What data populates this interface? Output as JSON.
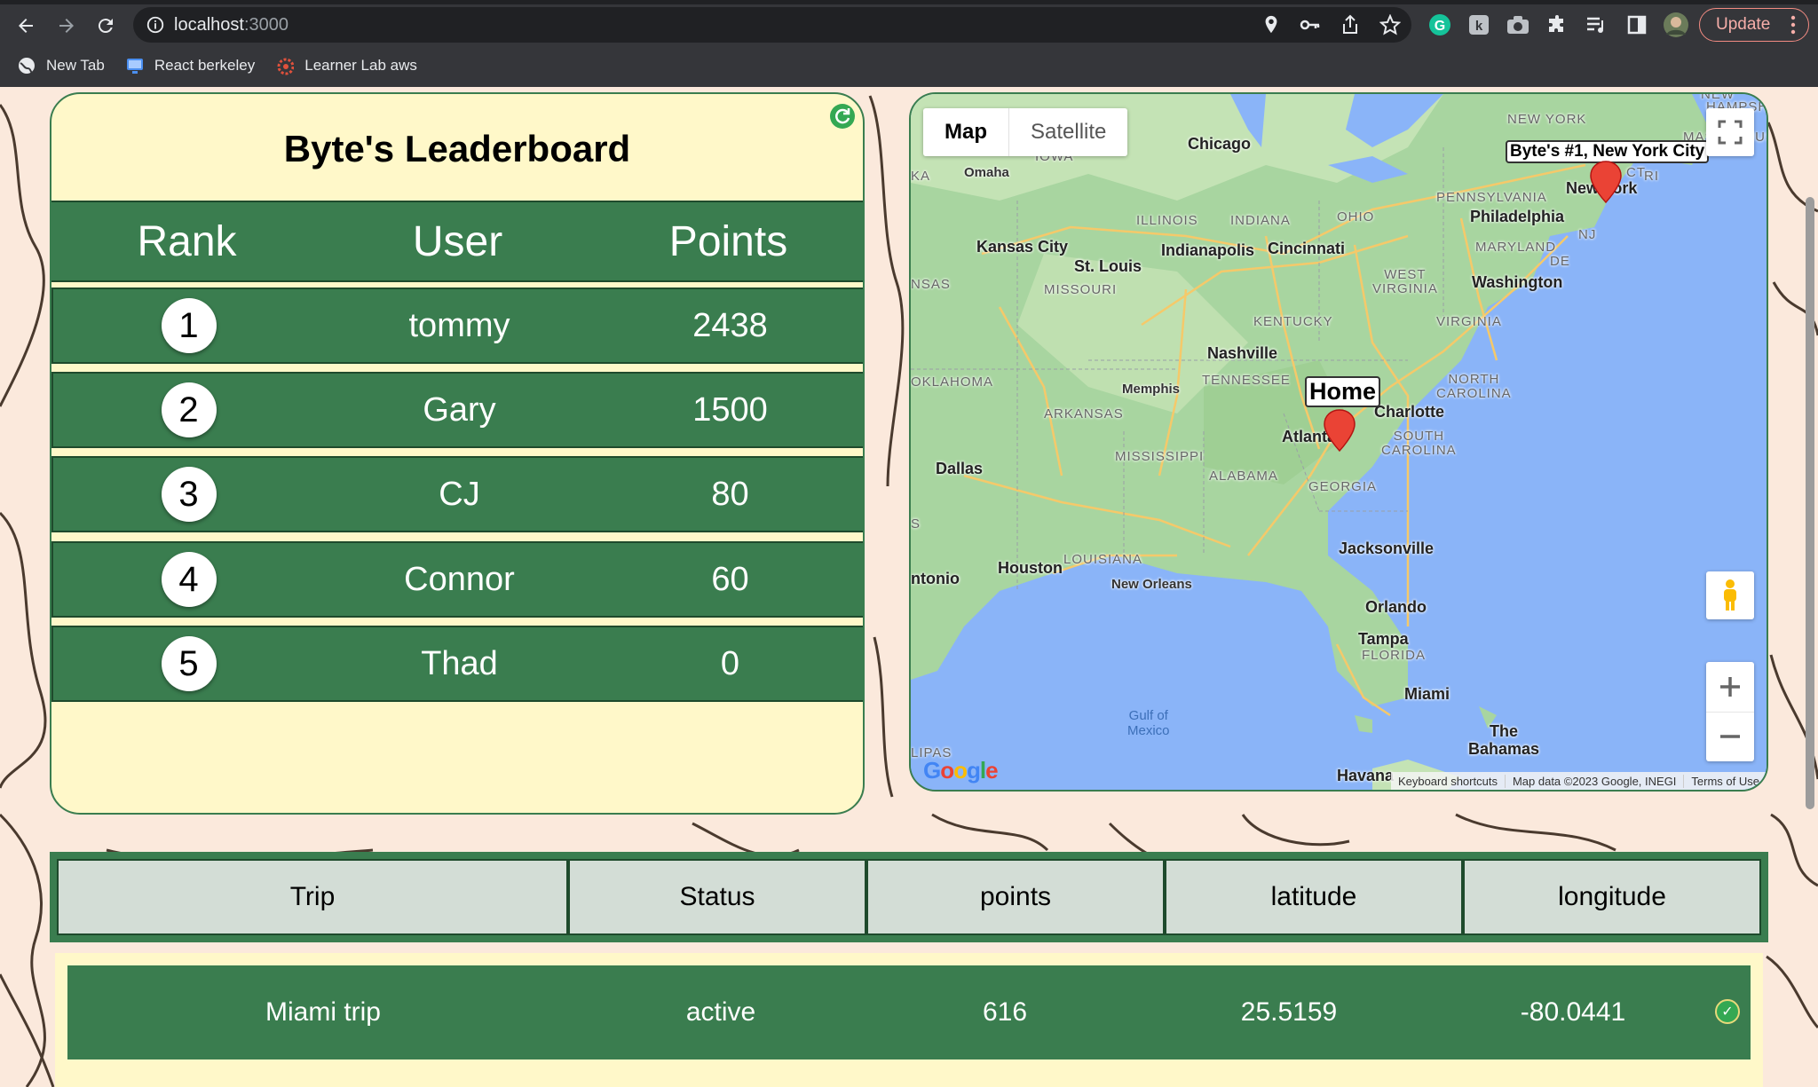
{
  "browser": {
    "url_host": "localhost",
    "url_port": ":3000",
    "update_label": "Update",
    "bookmarks": [
      {
        "label": "New Tab",
        "icon": "globe-icon"
      },
      {
        "label": "React berkeley",
        "icon": "monitor-icon"
      },
      {
        "label": "Learner Lab aws",
        "icon": "aws-icon"
      }
    ]
  },
  "leaderboard": {
    "title": "Byte's Leaderboard",
    "columns": [
      "Rank",
      "User",
      "Points"
    ],
    "rows": [
      {
        "rank": "1",
        "user": "tommy",
        "points": "2438"
      },
      {
        "rank": "2",
        "user": "Gary",
        "points": "1500"
      },
      {
        "rank": "3",
        "user": "CJ",
        "points": "80"
      },
      {
        "rank": "4",
        "user": "Connor",
        "points": "60"
      },
      {
        "rank": "5",
        "user": "Thad",
        "points": "0"
      }
    ]
  },
  "map": {
    "type_buttons": {
      "map": "Map",
      "satellite": "Satellite"
    },
    "markers": {
      "nyc": "Byte's #1, New York City",
      "home": "Home"
    },
    "labels": {
      "chicago": "Chicago",
      "omaha": "Omaha",
      "iowa": "IOWA",
      "kansas_city": "Kansas City",
      "st_louis": "St. Louis",
      "missouri": "MISSOURI",
      "illinois": "ILLINOIS",
      "indiana": "INDIANA",
      "ohio": "OHIO",
      "indianapolis": "Indianapolis",
      "cincinnati": "Cincinnati",
      "pennsylvania": "PENNSYLVANIA",
      "new_york_state": "NEW YORK",
      "massachusetts": "MASSACHUSE",
      "hampshire": "HAMPSHIRE",
      "new": "NEW",
      "ct": "CT",
      "ri": "RI",
      "new_york": "New York",
      "philadelphia": "Philadelphia",
      "maryland": "MARYLAND",
      "nj": "NJ",
      "de": "DE",
      "west_virginia": "WEST\nVIRGINIA",
      "washington": "Washington",
      "virginia": "VIRGINIA",
      "kentucky": "KENTUCKY",
      "nashville": "Nashville",
      "tennessee": "TENNESSEE",
      "memphis": "Memphis",
      "oklahoma": "OKLAHOMA",
      "arkansas": "ARKANSAS",
      "north_carolina": "NORTH\nCAROLINA",
      "charlotte": "Charlotte",
      "atlanta": "Atlanta",
      "south_carolina": "SOUTH\nCAROLINA",
      "mississippi": "MISSISSIPPI",
      "alabama": "ALABAMA",
      "georgia": "GEORGIA",
      "dallas": "Dallas",
      "louisiana": "LOUISIANA",
      "houston": "Houston",
      "san_antonio": "ntonio",
      "new_orleans": "New Orleans",
      "jacksonville": "Jacksonville",
      "orlando": "Orlando",
      "tampa": "Tampa",
      "florida": "FLORIDA",
      "miami": "Miami",
      "bahamas": "The\nBahamas",
      "gulf": "Gulf of\nMexico",
      "havana": "Havana",
      "ka": "KA",
      "nsas": "NSAS",
      "s": "S",
      "lipas": "LIPAS"
    },
    "google": "Google",
    "footer": [
      "Keyboard shortcuts",
      "Map data ©2023 Google, INEGI",
      "Terms of Use"
    ]
  },
  "trips": {
    "columns": [
      "Trip",
      "Status",
      "points",
      "latitude",
      "longitude"
    ],
    "rows": [
      {
        "trip": "Miami trip",
        "status": "active",
        "points": "616",
        "latitude": "25.5159",
        "longitude": "-80.0441"
      }
    ]
  }
}
